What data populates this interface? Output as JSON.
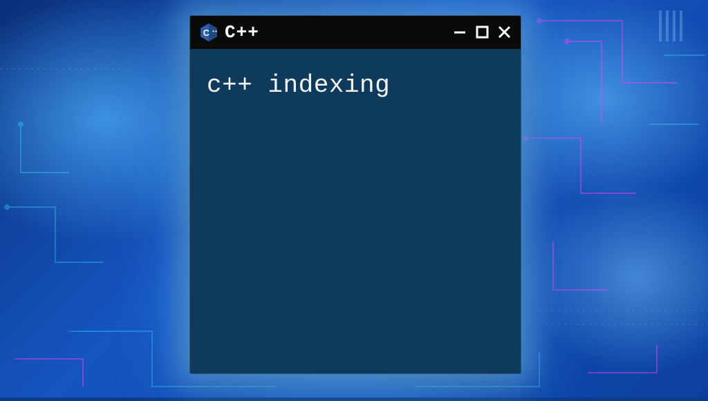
{
  "window": {
    "title": "C++",
    "content_text": "c++ indexing"
  },
  "colors": {
    "window_bg": "#0e3a5c",
    "titlebar_bg": "#0a0a0a",
    "icon_blue": "#2b5fa8",
    "backdrop_primary": "#1555c0"
  }
}
